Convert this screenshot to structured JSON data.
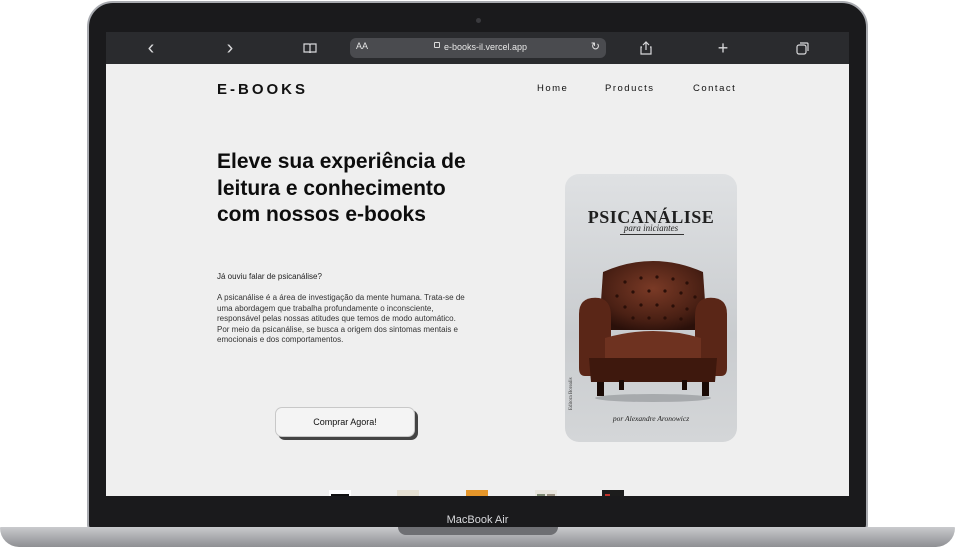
{
  "device": {
    "model_label": "MacBook Air"
  },
  "browser": {
    "text_size_label": "AA",
    "url": "e-books-il.vercel.app",
    "back_icon": "‹",
    "forward_icon": "›",
    "bookmarks_icon": "📖",
    "reload_icon": "↻",
    "share_icon": "⇪",
    "new_tab_icon": "+",
    "tabs_icon": "⧉"
  },
  "header": {
    "brand": "E-BOOKS",
    "nav": [
      "Home",
      "Products",
      "Contact"
    ]
  },
  "hero": {
    "headline": "Eleve sua experiência de leitura e conhecimento com nossos e-books",
    "lead": "Já ouviu falar de psicanálise?",
    "description": "A psicanálise é a área de investigação da mente humana. Trata-se de uma abordagem que trabalha profundamente o inconsciente, responsável pelas nossas atitudes que temos de modo automático.\nPor meio da psicanálise, se busca a origem dos sintomas mentais e emocionais e dos comportamentos.",
    "cta_label": "Comprar Agora!"
  },
  "featured_book": {
    "title": "PSICANÁLISE",
    "subtitle": "para iniciantes",
    "author": "por Alexandre Aronowicz",
    "publisher": "Editora Borealis"
  },
  "thumbnails": [
    {
      "name": "book-thumbnail-blue",
      "color": "#3b63b5"
    },
    {
      "name": "book-thumbnail-grey",
      "color": "#b7b09b"
    },
    {
      "name": "book-thumbnail-orange",
      "color": "#e5962a"
    },
    {
      "name": "book-thumbnail-white",
      "color": "#d8d4cc"
    },
    {
      "name": "book-thumbnail-black",
      "color": "#1c1c1c"
    }
  ]
}
